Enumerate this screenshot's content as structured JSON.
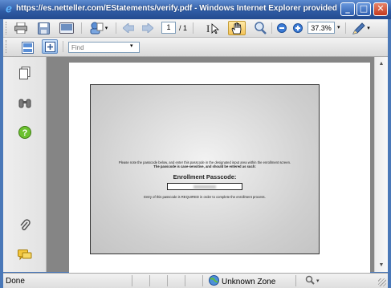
{
  "window": {
    "title": "https://es.netteller.com/EStatements/verify.pdf - Windows Internet Explorer provided by Jack...",
    "minimize": "_",
    "maximize": "□",
    "close": "✕"
  },
  "toolbar": {
    "page_current": "1",
    "page_total": "/ 1",
    "zoom_value": "37.3%",
    "find_placeholder": "Find"
  },
  "document": {
    "note_line1": "Please note the passcode below, and enter this passcode in the designated input area within the enrollment screen.",
    "note_line2": "The passcode is case-sensitive, and should be entered as such:",
    "passcode_label": "Enrollment Passcode:",
    "required_note": "Entry of this passcode is REQUIRED in order to complete the enrollment process."
  },
  "statusbar": {
    "status": "Done",
    "zone": "Unknown Zone"
  },
  "icons": {
    "window": "ie-icon",
    "print": "printer-icon",
    "save": "save-icon",
    "email": "email-icon",
    "tools": "collaborate-icon",
    "prev_page": "arrow-left-icon",
    "next_page": "arrow-right-icon",
    "select_text": "text-select-icon",
    "hand": "hand-icon",
    "zoom_tool": "zoom-tool-icon",
    "zoom_out": "zoom-out-icon",
    "zoom_in": "zoom-in-icon",
    "sign": "pen-icon",
    "pages": "pages-icon",
    "attachments_binoculars": "binoculars-icon",
    "help": "help-icon",
    "attachments": "paperclip-icon",
    "comments": "comments-icon"
  }
}
